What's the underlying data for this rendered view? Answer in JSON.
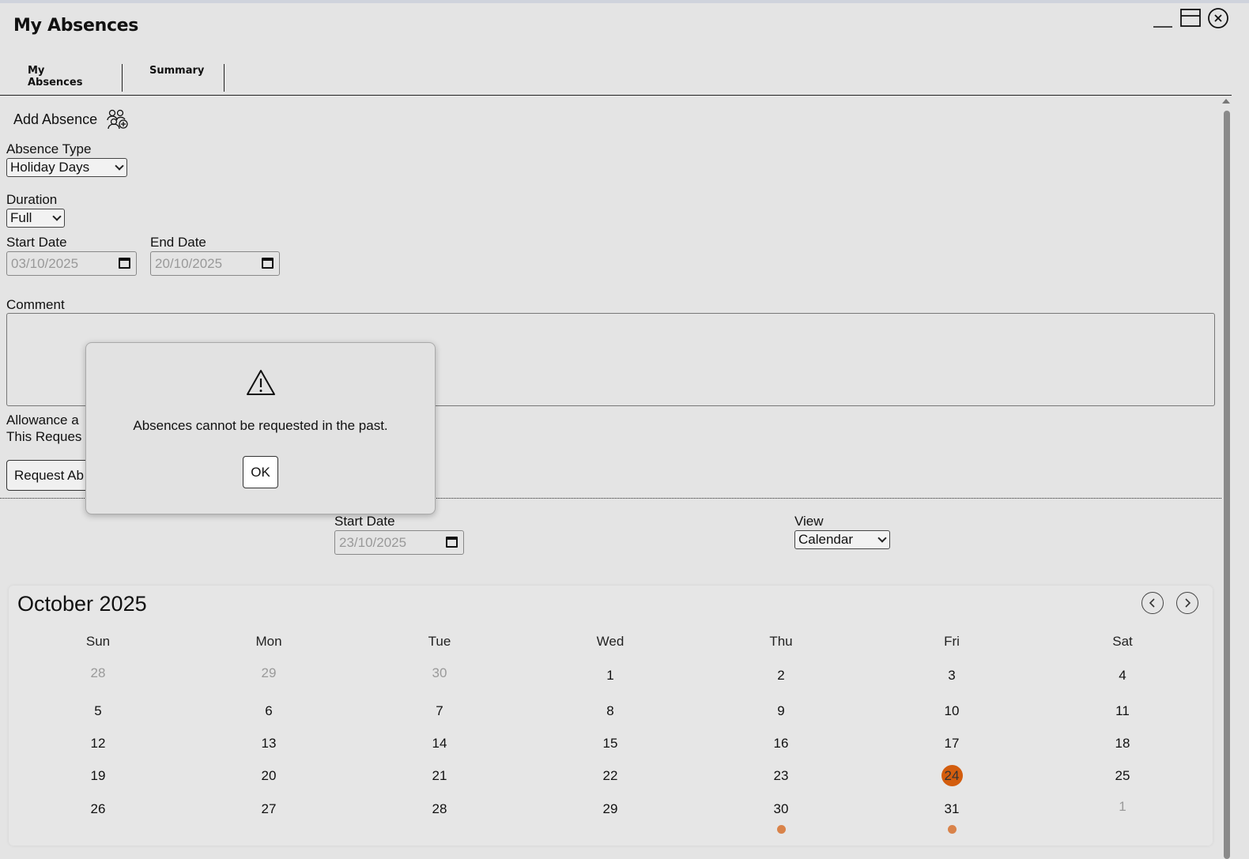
{
  "window": {
    "title": "My Absences",
    "controls": [
      "minimize-icon",
      "restore-icon",
      "close-icon"
    ]
  },
  "tabs": [
    {
      "label": "My Absences",
      "active": true
    },
    {
      "label": "Summary",
      "active": false
    }
  ],
  "form": {
    "add_absence_label": "Add Absence",
    "absence_type_label": "Absence Type",
    "absence_type_value": "Holiday Days",
    "duration_label": "Duration",
    "duration_value": "Full",
    "start_date_label": "Start Date",
    "start_date_value": "03/10/2025",
    "end_date_label": "End Date",
    "end_date_value": "20/10/2025",
    "comment_label": "Comment",
    "allowance_text": "Allowance a",
    "this_request_text": "This Reques",
    "request_button": "Request Ab"
  },
  "filter": {
    "start_date_label": "Start Date",
    "start_date_value": "23/10/2025",
    "view_label": "View",
    "view_value": "Calendar"
  },
  "dialog": {
    "icon": "warning-icon",
    "message": "Absences cannot be requested in the past.",
    "ok_label": "OK"
  },
  "calendar": {
    "month_title": "October 2025",
    "weekdays": [
      "Sun",
      "Mon",
      "Tue",
      "Wed",
      "Thu",
      "Fri",
      "Sat"
    ],
    "weeks": [
      [
        "28",
        "29",
        "30",
        "1",
        "2",
        "3",
        "4"
      ],
      [
        "5",
        "6",
        "7",
        "8",
        "9",
        "10",
        "11"
      ],
      [
        "12",
        "13",
        "14",
        "15",
        "16",
        "17",
        "18"
      ],
      [
        "19",
        "20",
        "21",
        "22",
        "23",
        "24",
        "25"
      ],
      [
        "26",
        "27",
        "28",
        "29",
        "30",
        "31",
        "1"
      ]
    ],
    "today": "24",
    "marked_days": [
      "30",
      "31"
    ],
    "accent_color": "#d35d0e",
    "marker_color": "#d9834a"
  }
}
